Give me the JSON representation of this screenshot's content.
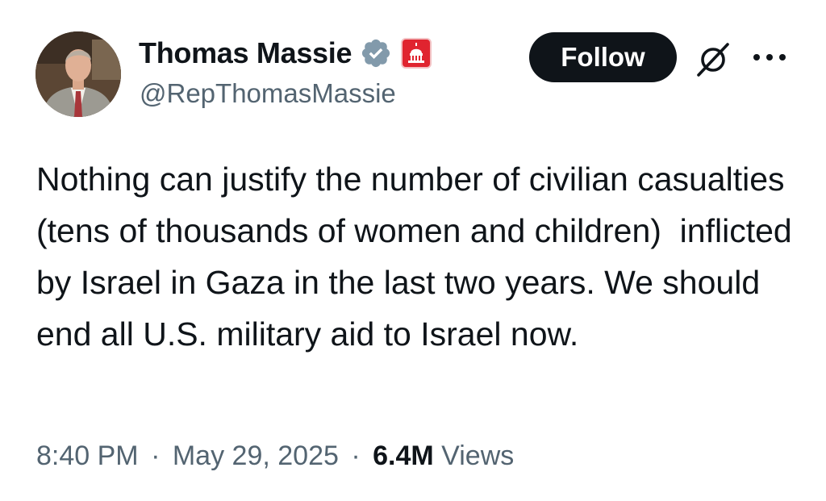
{
  "author": {
    "display_name": "Thomas Massie",
    "handle": "@RepThomasMassie",
    "verified_badge_icon": "verified-badge-icon",
    "verified_color": "#829aab",
    "affiliation_badge_icon": "us-house-capitol-icon",
    "affiliation_color": "#e0242f"
  },
  "actions": {
    "follow_label": "Follow",
    "grok_icon": "grok-icon",
    "more_icon": "more-options-icon"
  },
  "tweet": {
    "text": "Nothing can justify the number of civilian casualties (tens of thousands of women and children)  inflicted by Israel in Gaza in the last two years. We should end all U.S. military aid to Israel now."
  },
  "meta": {
    "time": "8:40 PM",
    "separator": "·",
    "date": "May 29, 2025",
    "views_count": "6.4M",
    "views_label": "Views"
  }
}
